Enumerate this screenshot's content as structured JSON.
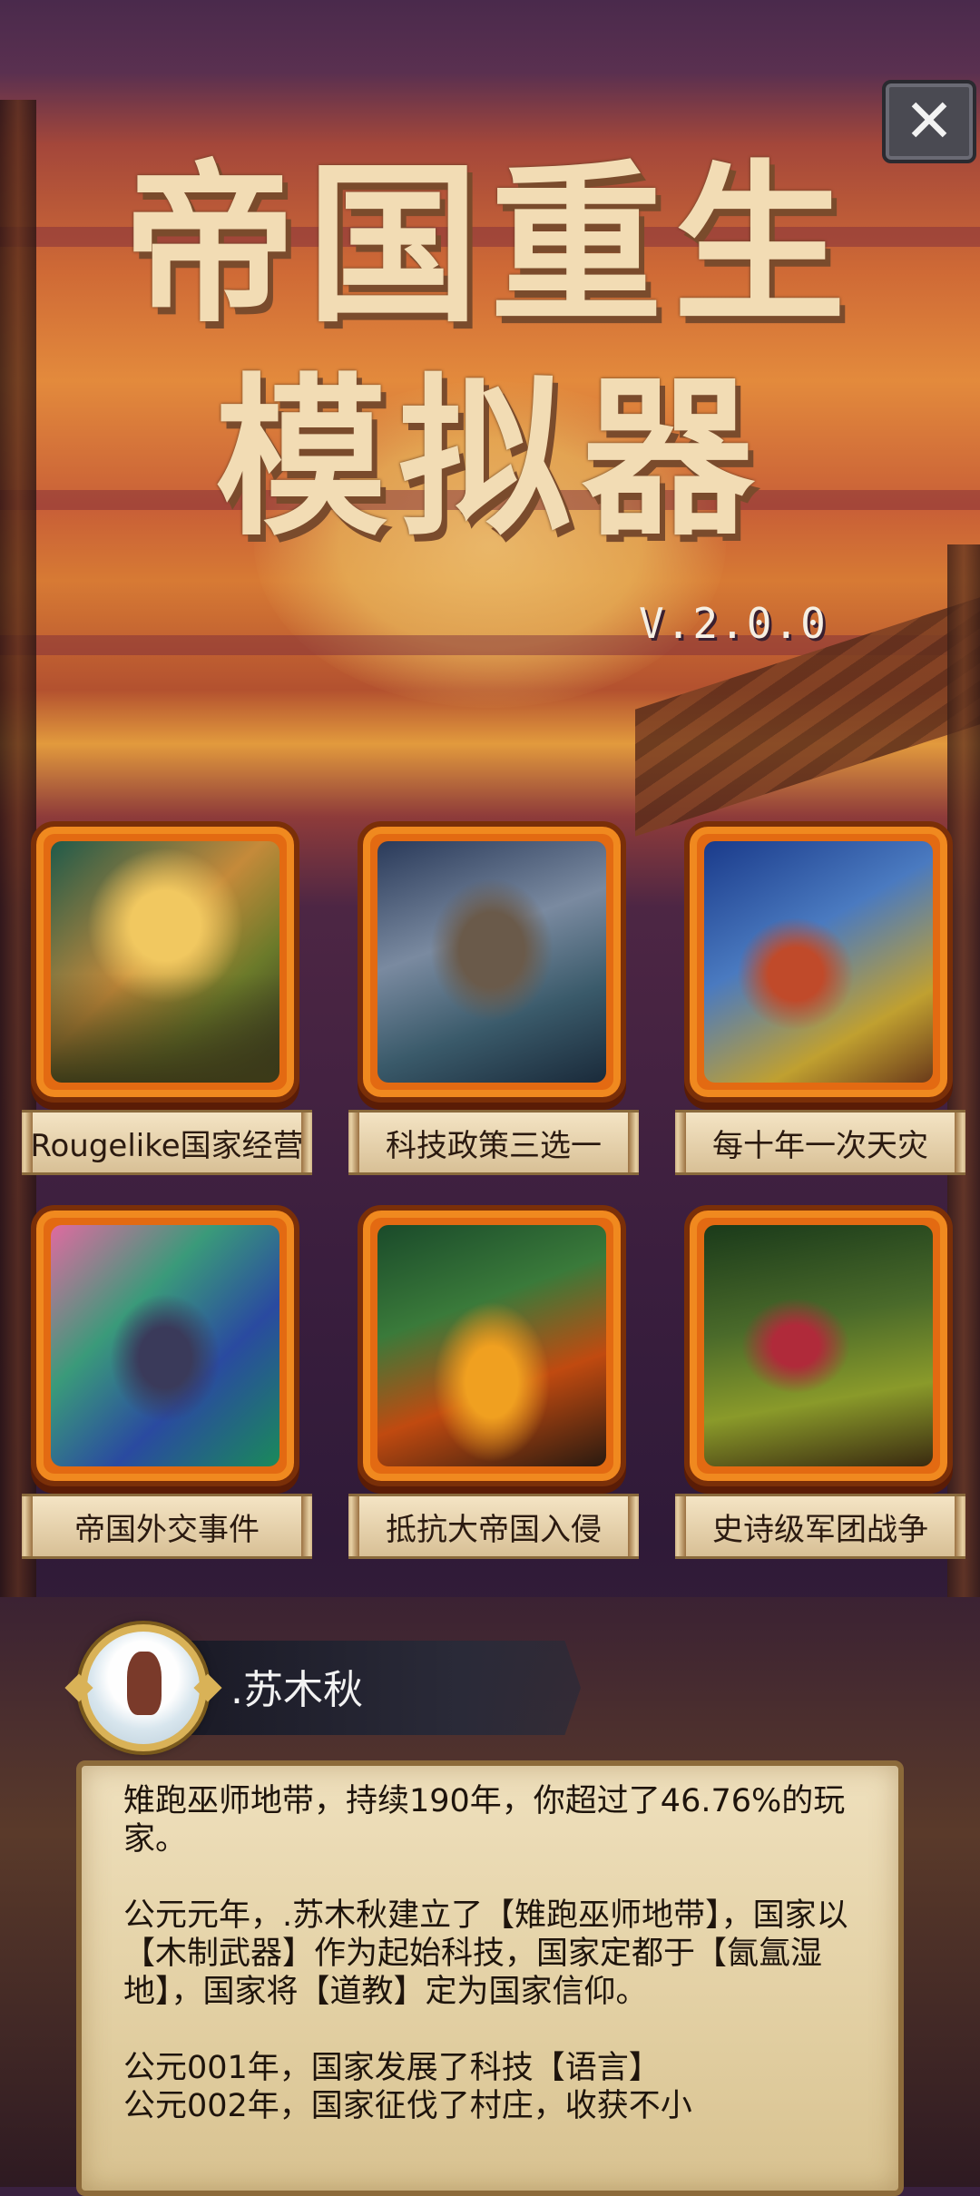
{
  "header": {
    "title_line1": "帝国重生",
    "title_line2": "模拟器",
    "version": "V.2.0.0",
    "close_icon": "close-icon"
  },
  "features": [
    {
      "label": "Rougelike国家经营",
      "icon": "town-art"
    },
    {
      "label": "科技政策三选一",
      "icon": "statue-art"
    },
    {
      "label": "每十年一次天灾",
      "icon": "knights-art"
    },
    {
      "label": "帝国外交事件",
      "icon": "warrior-art"
    },
    {
      "label": "抵抗大帝国入侵",
      "icon": "battle-fire-art"
    },
    {
      "label": "史诗级军团战争",
      "icon": "army-art"
    }
  ],
  "profile": {
    "name": ".苏木秋",
    "avatar": "avatar"
  },
  "log": {
    "summary": "雉跑巫师地带，持续190年，你超过了46.76%的玩家。",
    "paragraph": "公元元年，.苏木秋建立了【雉跑巫师地带】，国家以【木制武器】作为起始科技，国家定都于【氤氲湿地】，国家将【道教】定为国家信仰。",
    "line1": "公元001年，国家发展了科技【语言】",
    "line2": "公元002年，国家征伐了村庄，收获不小"
  },
  "colors": {
    "frame_orange": "#e36a12",
    "title_text": "#f2dcb4",
    "parchment": "#efe0bd"
  }
}
